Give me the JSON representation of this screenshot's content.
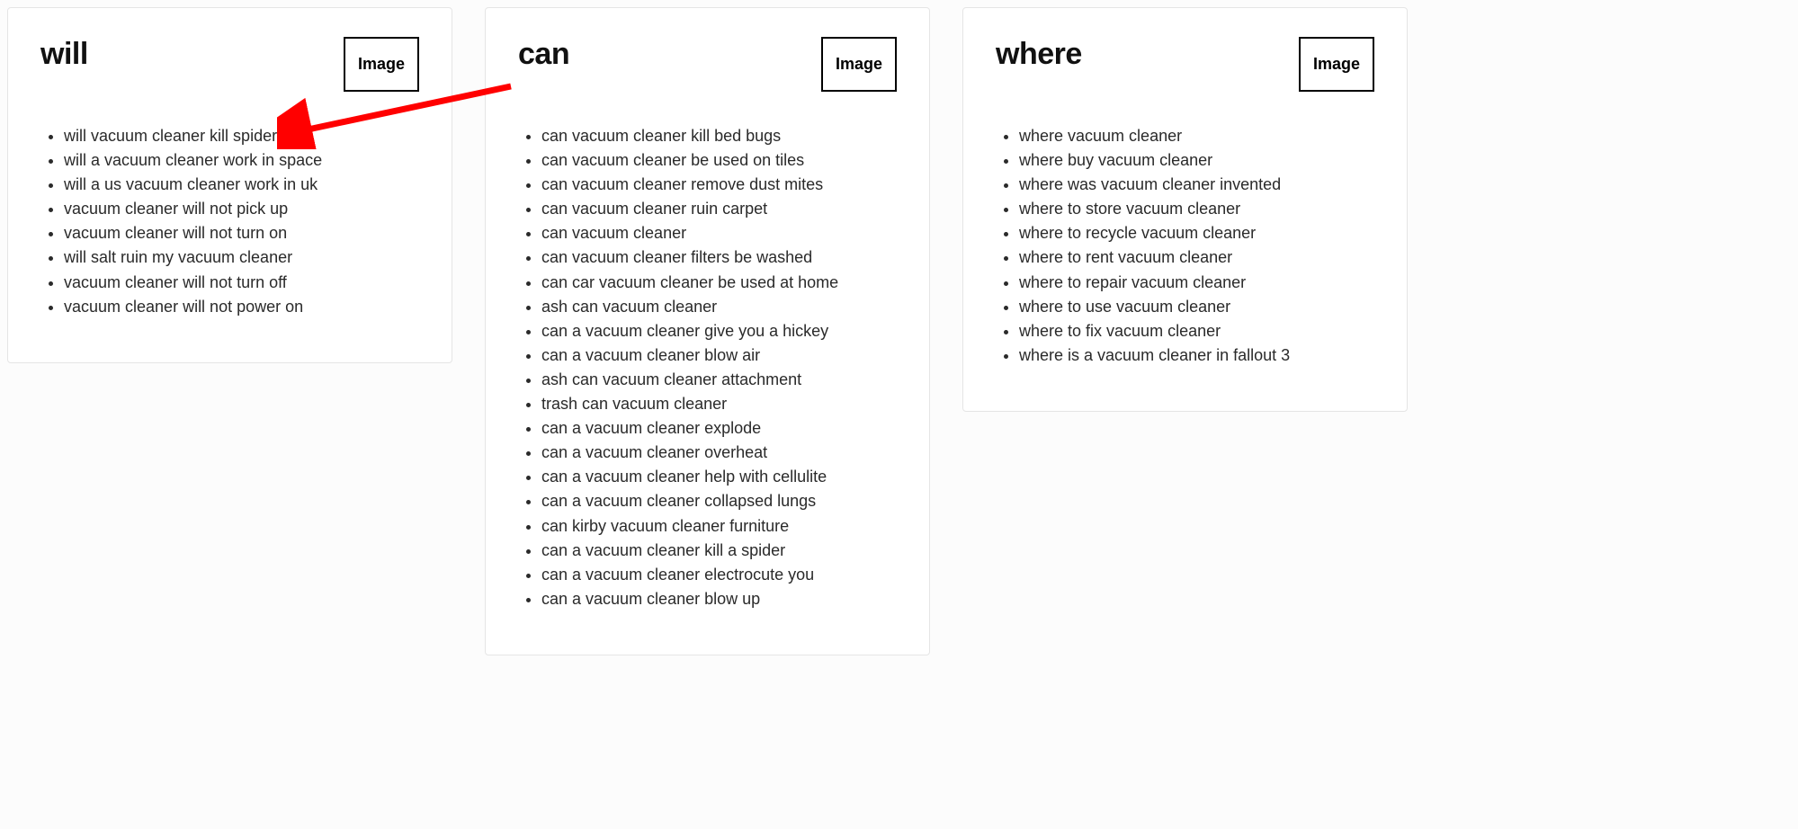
{
  "image_button_label": "Image",
  "cards": [
    {
      "title": "will",
      "items": [
        "will vacuum cleaner kill spider",
        "will a vacuum cleaner work in space",
        "will a us vacuum cleaner work in uk",
        "vacuum cleaner will not pick up",
        "vacuum cleaner will not turn on",
        "will salt ruin my vacuum cleaner",
        "vacuum cleaner will not turn off",
        "vacuum cleaner will not power on"
      ]
    },
    {
      "title": "can",
      "items": [
        "can vacuum cleaner kill bed bugs",
        "can vacuum cleaner be used on tiles",
        "can vacuum cleaner remove dust mites",
        "can vacuum cleaner ruin carpet",
        "can vacuum cleaner",
        "can vacuum cleaner filters be washed",
        "can car vacuum cleaner be used at home",
        "ash can vacuum cleaner",
        "can a vacuum cleaner give you a hickey",
        "can a vacuum cleaner blow air",
        "ash can vacuum cleaner attachment",
        "trash can vacuum cleaner",
        "can a vacuum cleaner explode",
        "can a vacuum cleaner overheat",
        "can a vacuum cleaner help with cellulite",
        "can a vacuum cleaner collapsed lungs",
        "can kirby vacuum cleaner furniture",
        "can a vacuum cleaner kill a spider",
        "can a vacuum cleaner electrocute you",
        "can a vacuum cleaner blow up"
      ]
    },
    {
      "title": "where",
      "items": [
        "where vacuum cleaner",
        "where buy vacuum cleaner",
        "where was vacuum cleaner invented",
        "where to store vacuum cleaner",
        "where to recycle vacuum cleaner",
        "where to rent vacuum cleaner",
        "where to repair vacuum cleaner",
        "where to use vacuum cleaner",
        "where to fix vacuum cleaner",
        "where is a vacuum cleaner in fallout 3"
      ]
    }
  ],
  "annotation": {
    "color": "#ff0000"
  }
}
